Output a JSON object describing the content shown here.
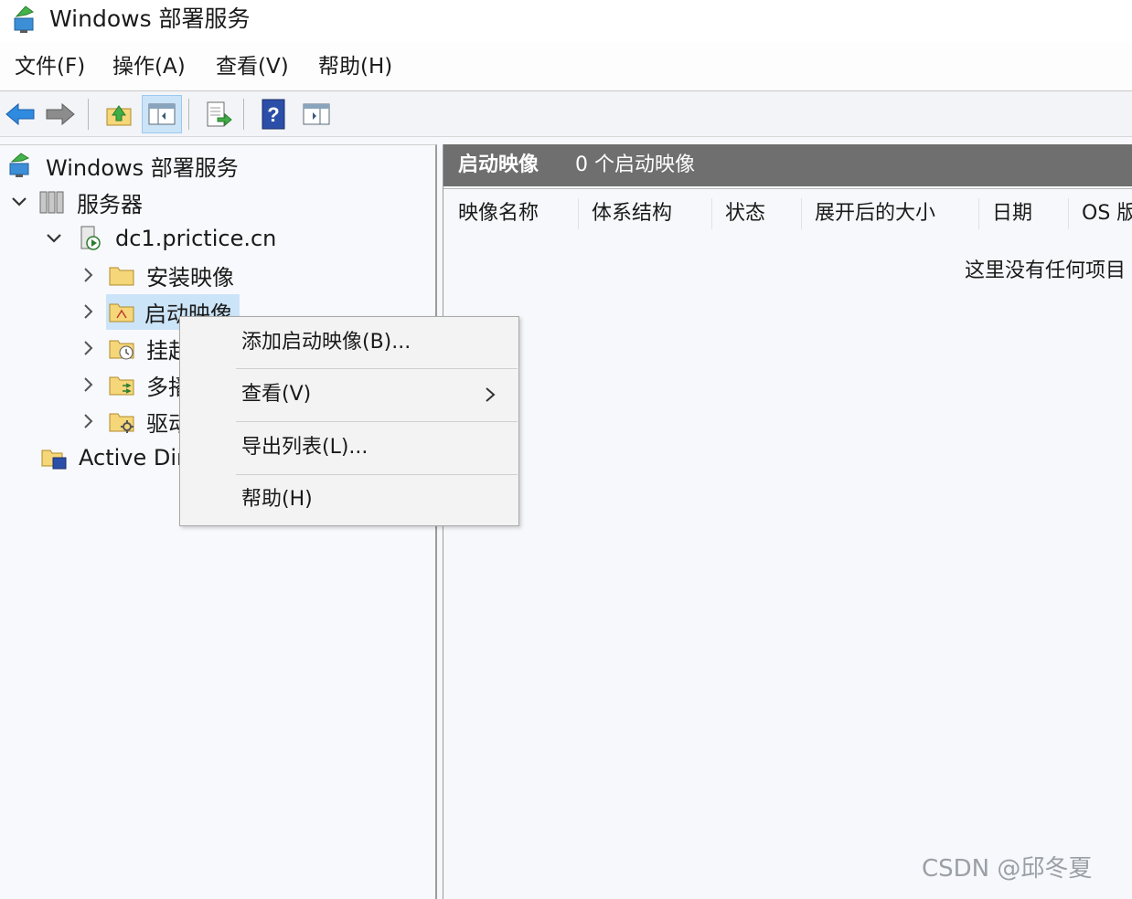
{
  "window": {
    "title": "Windows 部署服务"
  },
  "menubar": [
    {
      "label": "文件(F)"
    },
    {
      "label": "操作(A)"
    },
    {
      "label": "查看(V)"
    },
    {
      "label": "帮助(H)"
    }
  ],
  "toolbar": {
    "buttons": [
      "back-icon",
      "forward-icon",
      "up-folder-icon",
      "show-hide-tree-icon",
      "export-list-icon",
      "help-icon",
      "show-hide-action-pane-icon"
    ]
  },
  "tree": {
    "root": "Windows 部署服务",
    "servers": "服务器",
    "server_name": "dc1.prictice.cn",
    "nodes": [
      "安装映像",
      "启动映像",
      "挂起",
      "多播",
      "驱动"
    ],
    "active_directory": "Active Dir"
  },
  "right_pane": {
    "title": "启动映像",
    "count": "0 个启动映像",
    "columns": [
      "映像名称",
      "体系结构",
      "状态",
      "展开后的大小",
      "日期",
      "OS 版"
    ],
    "empty_message": "这里没有任何项目"
  },
  "context_menu": {
    "items": [
      {
        "label": "添加启动映像(B)..."
      },
      {
        "label": "查看(V)"
      },
      {
        "label": "导出列表(L)..."
      },
      {
        "label": "帮助(H)"
      }
    ]
  },
  "watermark": "CSDN @邱冬夏",
  "colors": {
    "selection": "#cce4f7",
    "header_bg": "#6f6f6f",
    "accent_blue": "#2f6fd6",
    "folder": "#f5d77a"
  }
}
